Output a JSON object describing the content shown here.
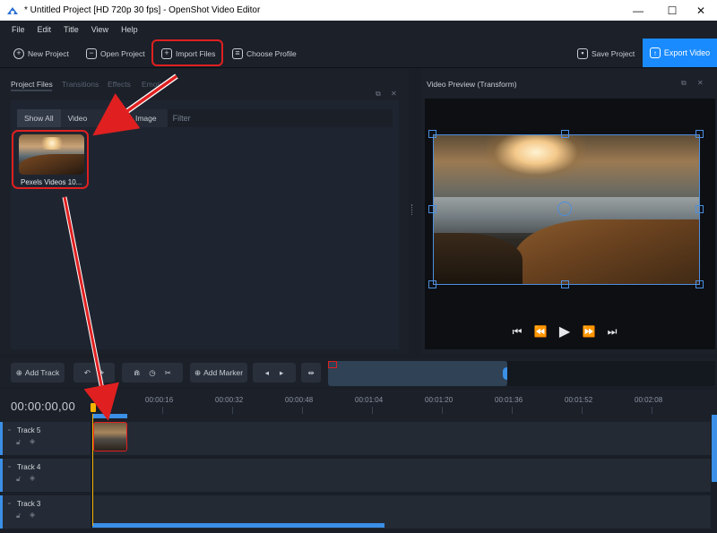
{
  "window": {
    "title": "* Untitled Project [HD 720p 30 fps] - OpenShot Video Editor",
    "minimize": "—",
    "maximize": "☐",
    "close": "✕"
  },
  "menu": [
    "File",
    "Edit",
    "Title",
    "View",
    "Help"
  ],
  "toolbar": {
    "new_project": "New Project",
    "open_project": "Open Project",
    "import_files": "Import Files",
    "choose_profile": "Choose Profile",
    "save_project": "Save Project",
    "export_video": "Export Video"
  },
  "left_panel": {
    "tabs": [
      "Project Files",
      "Transitions",
      "Effects",
      "Emoji"
    ],
    "filters": [
      "Show All",
      "Video",
      "Audio",
      "Image"
    ],
    "filter_placeholder": "Filter",
    "file_label": "Pexels Videos 10..."
  },
  "preview": {
    "title": "Video Preview (Transform)"
  },
  "timeline_toolbar": {
    "add_track": "Add Track",
    "add_marker": "Add Marker"
  },
  "timeline": {
    "timecode": "00:00:00,00",
    "ticks": [
      "00:00:16",
      "00:00:32",
      "00:00:48",
      "00:01:04",
      "00:01:20",
      "00:01:36",
      "00:01:52",
      "00:02:08"
    ],
    "tracks": [
      "Track 5",
      "Track 4",
      "Track 3"
    ]
  },
  "colors": {
    "accent": "#1a8bff",
    "highlight": "#e02020",
    "playhead": "#f5b400"
  }
}
